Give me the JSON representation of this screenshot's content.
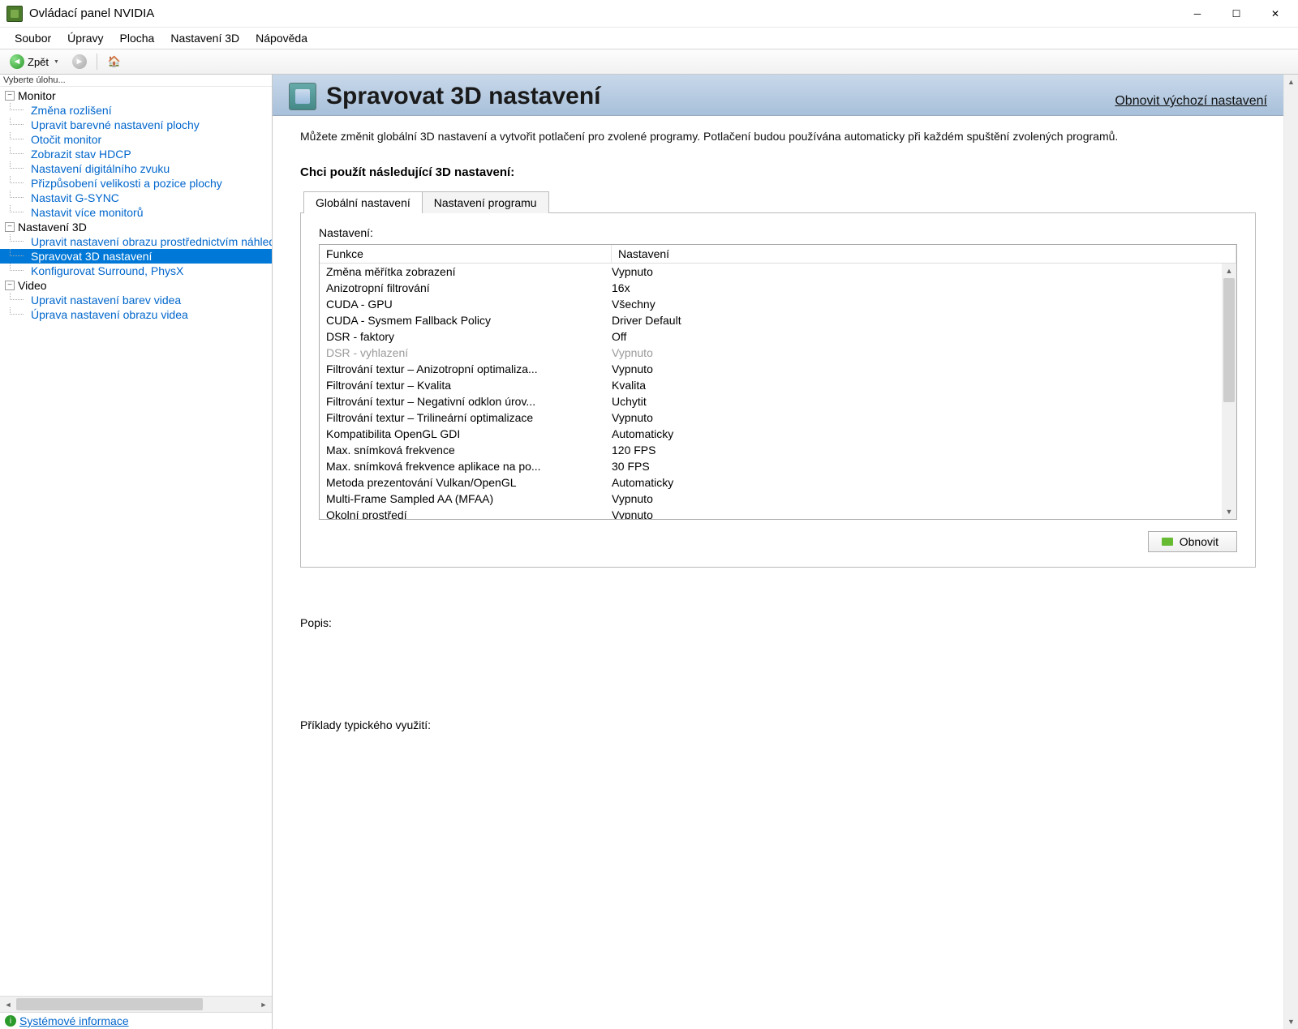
{
  "window": {
    "title": "Ovládací panel NVIDIA"
  },
  "menubar": {
    "items": [
      "Soubor",
      "Úpravy",
      "Plocha",
      "Nastavení 3D",
      "Nápověda"
    ]
  },
  "toolbar": {
    "back_label": "Zpět"
  },
  "sidebar": {
    "header": "Vyberte úlohu...",
    "groups": [
      {
        "label": "Monitor",
        "items": [
          "Změna rozlišení",
          "Upravit barevné nastavení plochy",
          "Otočit monitor",
          "Zobrazit stav HDCP",
          "Nastavení digitálního zvuku",
          "Přizpůsobení velikosti a pozice plochy",
          "Nastavit G-SYNC",
          "Nastavit více monitorů"
        ]
      },
      {
        "label": "Nastavení 3D",
        "items": [
          "Upravit nastavení obrazu prostřednictvím náhledu",
          "Spravovat 3D nastavení",
          "Konfigurovat Surround, PhysX"
        ],
        "selected_index": 1
      },
      {
        "label": "Video",
        "items": [
          "Upravit nastavení barev videa",
          "Úprava nastavení obrazu videa"
        ]
      }
    ],
    "footer_link": "Systémové informace"
  },
  "page": {
    "title": "Spravovat 3D nastavení",
    "restore": "Obnovit výchozí nastavení",
    "intro": "Můžete změnit globální 3D nastavení a vytvořit potlačení pro zvolené programy. Potlačení budou používána automaticky při každém spuštění zvolených programů.",
    "section": "Chci použít následující 3D nastavení:",
    "tabs": {
      "global": "Globální nastavení",
      "program": "Nastavení programu"
    },
    "settings_label": "Nastavení:",
    "grid": {
      "cols": {
        "feature": "Funkce",
        "setting": "Nastavení"
      },
      "rows": [
        {
          "feature": "Změna měřítka zobrazení",
          "setting": "Vypnuto"
        },
        {
          "feature": "Anizotropní filtrování",
          "setting": "16x"
        },
        {
          "feature": "CUDA - GPU",
          "setting": "Všechny"
        },
        {
          "feature": "CUDA - Sysmem Fallback Policy",
          "setting": "Driver Default"
        },
        {
          "feature": "DSR - faktory",
          "setting": "Off"
        },
        {
          "feature": "DSR - vyhlazení",
          "setting": "Vypnuto",
          "disabled": true
        },
        {
          "feature": "Filtrování textur – Anizotropní optimaliza...",
          "setting": "Vypnuto"
        },
        {
          "feature": "Filtrování textur – Kvalita",
          "setting": "Kvalita"
        },
        {
          "feature": "Filtrování textur – Negativní odklon úrov...",
          "setting": "Uchytit"
        },
        {
          "feature": "Filtrování textur – Trilineární optimalizace",
          "setting": "Vypnuto"
        },
        {
          "feature": "Kompatibilita OpenGL GDI",
          "setting": "Automaticky"
        },
        {
          "feature": "Max. snímková frekvence",
          "setting": "120 FPS"
        },
        {
          "feature": "Max. snímková frekvence aplikace na po...",
          "setting": "30 FPS"
        },
        {
          "feature": "Metoda prezentování Vulkan/OpenGL",
          "setting": "Automaticky"
        },
        {
          "feature": "Multi-Frame Sampled AA (MFAA)",
          "setting": "Vypnuto"
        },
        {
          "feature": "Okolní prostředí",
          "setting": "Vypnuto"
        }
      ]
    },
    "restore_button": "Obnovit",
    "description_label": "Popis:",
    "usage_label": "Příklady typického využití:"
  }
}
